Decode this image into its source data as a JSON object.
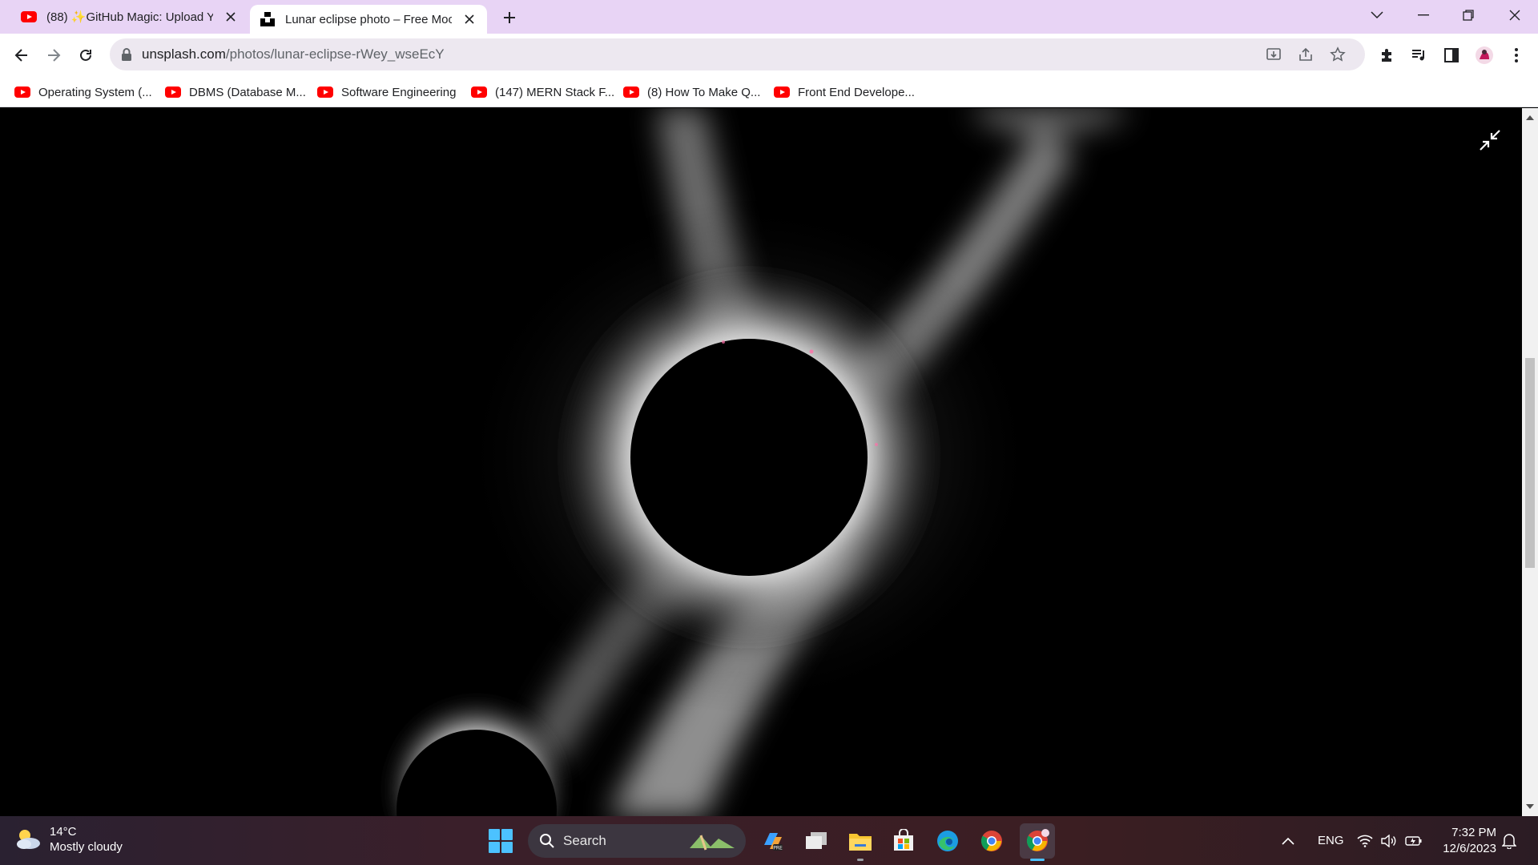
{
  "browser": {
    "tabs": [
      {
        "label": "(88) ✨GitHub Magic: Upload Yo",
        "favicon": "youtube-icon",
        "active": false
      },
      {
        "label": "Lunar eclipse photo – Free Moo",
        "favicon": "unsplash-icon",
        "active": true
      }
    ],
    "url_host": "unsplash.com",
    "url_path": "/photos/lunar-eclipse-rWey_wseEcY"
  },
  "bookmarks": [
    {
      "label": "Operating System (...",
      "icon": "youtube-icon"
    },
    {
      "label": "DBMS (Database M...",
      "icon": "youtube-icon"
    },
    {
      "label": "Software Engineering",
      "icon": "youtube-icon"
    },
    {
      "label": "(147) MERN Stack F...",
      "icon": "youtube-icon"
    },
    {
      "label": "(8) How To Make Q...",
      "icon": "youtube-icon"
    },
    {
      "label": "Front End Develope...",
      "icon": "youtube-icon"
    }
  ],
  "content": {
    "image_subject": "total solar eclipse corona",
    "colors": {
      "background": "#000000",
      "corona": "#ffffff"
    }
  },
  "taskbar": {
    "weather": {
      "temp": "14°C",
      "condition": "Mostly cloudy"
    },
    "search_placeholder": "Search",
    "language": "ENG",
    "time": "7:32 PM",
    "date": "12/6/2023"
  },
  "colors": {
    "tabstrip": "#e8d4f5",
    "omnibox": "#ede8f0",
    "accent": "#4cc2ff"
  }
}
